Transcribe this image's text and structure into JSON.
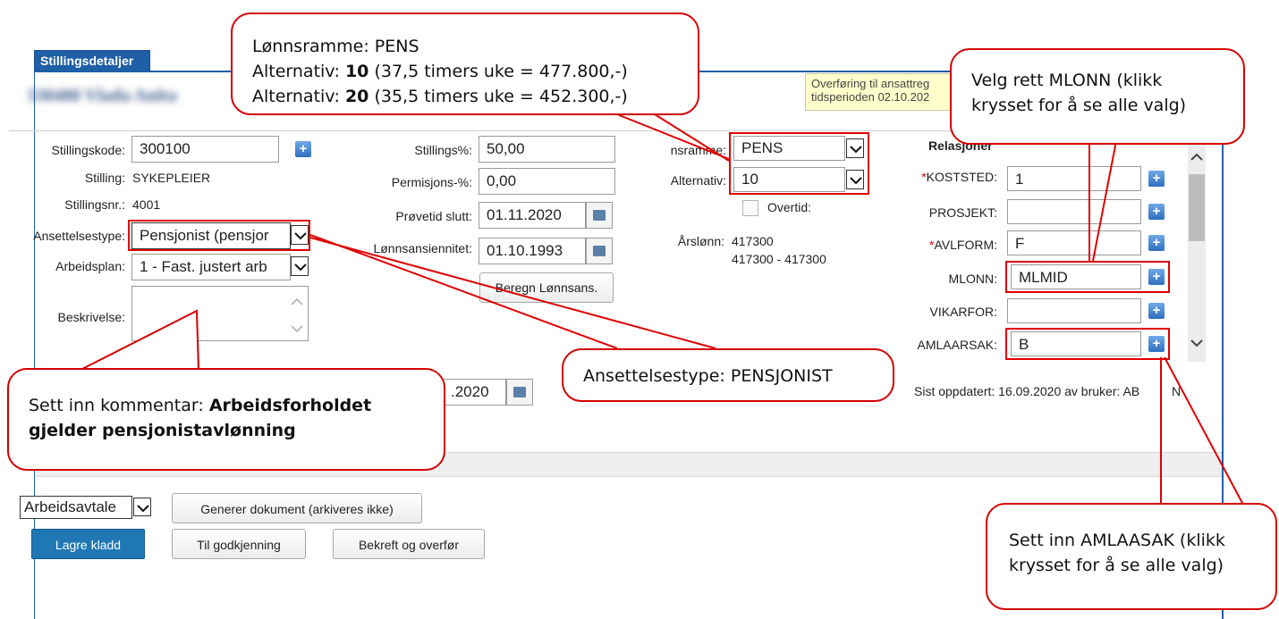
{
  "tab": {
    "label": "Stillingsdetaljer"
  },
  "employee_name_blurred": "330480 Vlada Anita",
  "notice": {
    "text": "Overføring til ansattreg tidsperioden 02.10.202"
  },
  "left_fields": {
    "stillingskode_label": "Stillingskode:",
    "stillingskode_value": "300100",
    "stilling_label": "Stilling:",
    "stilling_value": "SYKEPLEIER",
    "stillingsnr_label": "Stillingsnr.:",
    "stillingsnr_value": "4001",
    "ansettelsestype_label": "Ansettelsestype:",
    "ansettelsestype_value": "Pensjonist (pensjor",
    "arbeidsplan_label": "Arbeidsplan:",
    "arbeidsplan_value": "1 - Fast. justert arb",
    "beskrivelse_label": "Beskrivelse:"
  },
  "middle_fields": {
    "stillings_pct_label": "Stillings%:",
    "stillings_pct_value": "50,00",
    "permisjons_pct_label": "Permisjons-%:",
    "permisjons_pct_value": "0,00",
    "provetid_label": "Prøvetid slutt:",
    "provetid_value": "01.11.2020",
    "lonnsansiennitet_label": "Lønnsansiennitet:",
    "lonnsansiennitet_value": "01.10.1993",
    "beregn_button": "Beregn Lønnsans.",
    "date_partial": ".2020"
  },
  "pay_fields": {
    "lonnsramme_label": "nsramme:",
    "lonnsramme_value": "PENS",
    "alternativ_label": "Alternativ:",
    "alternativ_value": "10",
    "overtid_label": "Overtid:",
    "arslonn_label": "Årslønn:",
    "arslonn_value": "417300",
    "arslonn_range": "417300 - 417300"
  },
  "relations": {
    "heading": "Relasjoner",
    "koststed_label": "KOSTSTED:",
    "koststed_value": "1",
    "prosjekt_label": "PROSJEKT:",
    "prosjekt_value": "",
    "avlform_label": "AVLFORM:",
    "avlform_value": "F",
    "mlonn_label": "MLONN:",
    "mlonn_value": "MLMID",
    "vikarfor_label": "VIKARFOR:",
    "vikarfor_value": "",
    "amlaarsak_label": "AMLAARSAK:",
    "amlaarsak_value": "B",
    "required_mark": "*",
    "sist_oppdatert": "Sist oppdatert: 16.09.2020 av bruker: AB",
    "sist_oppdatert_tail": "N"
  },
  "bottom": {
    "doc_select_value": "Arbeidsavtale",
    "generer_button": "Generer dokument (arkiveres ikke)",
    "lagre_button": "Lagre kladd",
    "godkjenning_button": "Til godkjenning",
    "bekreft_button": "Bekreft og overfør"
  },
  "callouts": {
    "lonnsramme_line1": "Lønnsramme: PENS",
    "lonnsramme_line2_prefix": "Alternativ: ",
    "lonnsramme_line2_bold": "10",
    "lonnsramme_line2_suffix": " (37,5 timers uke = 477.800,-)",
    "lonnsramme_line3_prefix": "Alternativ: ",
    "lonnsramme_line3_bold": "20",
    "lonnsramme_line3_suffix": " (35,5 timers uke = 452.300,-)",
    "mlonn_text": "Velg rett MLONN (klikk krysset for å se alle valg)",
    "kommentar_prefix": "Sett inn kommentar: ",
    "kommentar_bold": "Arbeidsforholdet gjelder pensjonistavlønning",
    "ansettelsestype_text": "Ansettelsestype: PENSJONIST",
    "amlaasak_text": "Sett inn AMLAASAK (klikk krysset for å se alle valg)"
  },
  "colors": {
    "accent_blue": "#1f5fa8",
    "button_blue": "#1f77b4",
    "highlight_red": "#e00000",
    "notice_yellow": "#ffffcc"
  }
}
